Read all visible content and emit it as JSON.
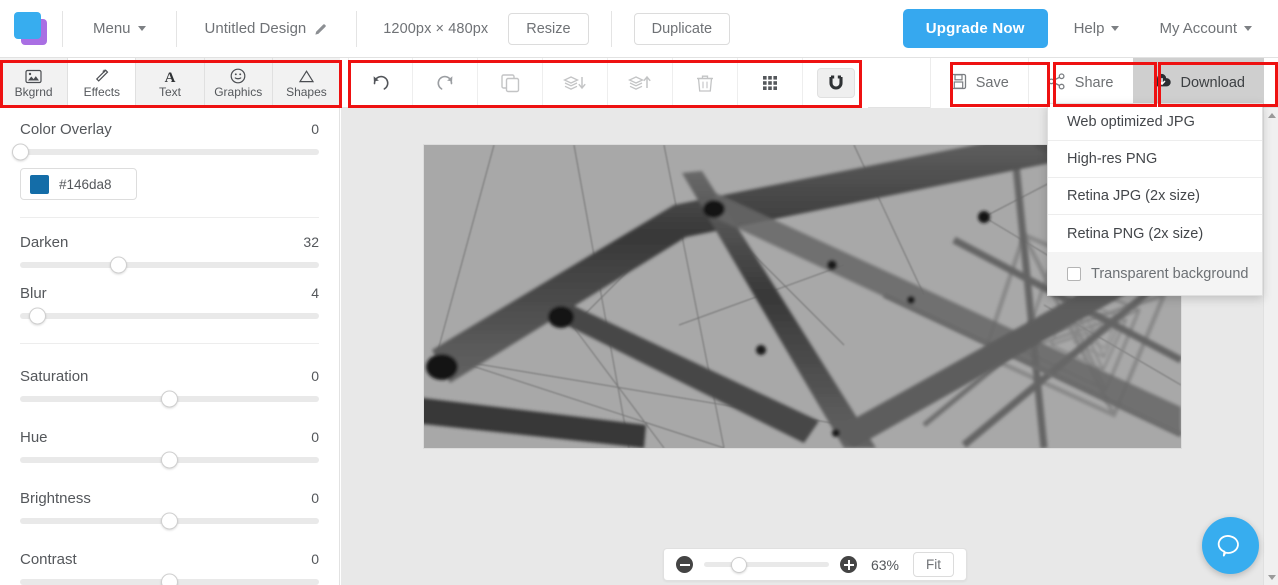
{
  "brand": {
    "accent": "#36a8ef",
    "logo_blue": "#37adef",
    "logo_purple": "#a96fe3",
    "annotation": "#ee1111"
  },
  "header": {
    "logo_icon": "stacked-squares-logo",
    "menu_label": "Menu",
    "design_title": "Untitled Design",
    "edit_icon": "pencil-icon",
    "dimensions": "1200px × 480px",
    "resize_label": "Resize",
    "duplicate_label": "Duplicate",
    "upgrade_label": "Upgrade Now",
    "help_label": "Help",
    "account_label": "My Account"
  },
  "tabs": [
    {
      "label": "Bkgrnd",
      "icon": "image-icon",
      "active": false
    },
    {
      "label": "Effects",
      "icon": "magic-wand-icon",
      "active": true
    },
    {
      "label": "Text",
      "icon": "letter-a-icon",
      "active": false
    },
    {
      "label": "Graphics",
      "icon": "smiley-icon",
      "active": false
    },
    {
      "label": "Shapes",
      "icon": "triangle-icon",
      "active": false
    }
  ],
  "toolbar": [
    {
      "name": "undo-button",
      "icon": "undo-icon",
      "enabled": true,
      "active": false
    },
    {
      "name": "redo-button",
      "icon": "redo-icon",
      "enabled": true,
      "active": false
    },
    {
      "name": "duplicate-button",
      "icon": "copy-icon",
      "enabled": false,
      "active": false
    },
    {
      "name": "send-backward-button",
      "icon": "layers-down-icon",
      "enabled": false,
      "active": false
    },
    {
      "name": "bring-forward-button",
      "icon": "layers-up-icon",
      "enabled": false,
      "active": false
    },
    {
      "name": "delete-button",
      "icon": "trash-icon",
      "enabled": false,
      "active": false
    },
    {
      "name": "grid-button",
      "icon": "grid-icon",
      "enabled": true,
      "active": false
    },
    {
      "name": "snap-button",
      "icon": "magnet-icon",
      "enabled": true,
      "active": true
    }
  ],
  "actions": {
    "save_label": "Save",
    "save_icon": "floppy-disk-icon",
    "share_label": "Share",
    "share_icon": "share-nodes-icon",
    "download_label": "Download",
    "download_icon": "cloud-download-icon"
  },
  "download_menu": {
    "items": [
      "Web optimized JPG",
      "High-res PNG",
      "Retina JPG (2x size)",
      "Retina PNG (2x size)"
    ],
    "transparent_label": "Transparent background",
    "transparent_checked": false
  },
  "effects_panel": {
    "controls": [
      {
        "label": "Color Overlay",
        "value": "0",
        "percent": 0
      },
      {
        "label": "Darken",
        "value": "32",
        "percent": 33
      },
      {
        "label": "Blur",
        "value": "4",
        "percent": 6
      },
      {
        "label": "Saturation",
        "value": "0",
        "percent": 50
      },
      {
        "label": "Hue",
        "value": "0",
        "percent": 50
      },
      {
        "label": "Brightness",
        "value": "0",
        "percent": 50
      },
      {
        "label": "Contrast",
        "value": "0",
        "percent": 50
      }
    ],
    "overlay_color_hex": "#146da8"
  },
  "zoom_control": {
    "minus_icon": "minus-circle-icon",
    "plus_icon": "plus-circle-icon",
    "level": "63%",
    "slider_percent": 28,
    "fit_label": "Fit"
  },
  "canvas": {
    "image_description": "grayscale upward view inside a steel lattice truss tower",
    "background_color": "#e8e8e8"
  },
  "chat": {
    "icon": "chat-bubble-icon"
  },
  "scrollbar": {
    "up_icon": "caret-up-icon",
    "down_icon": "caret-down-icon"
  }
}
